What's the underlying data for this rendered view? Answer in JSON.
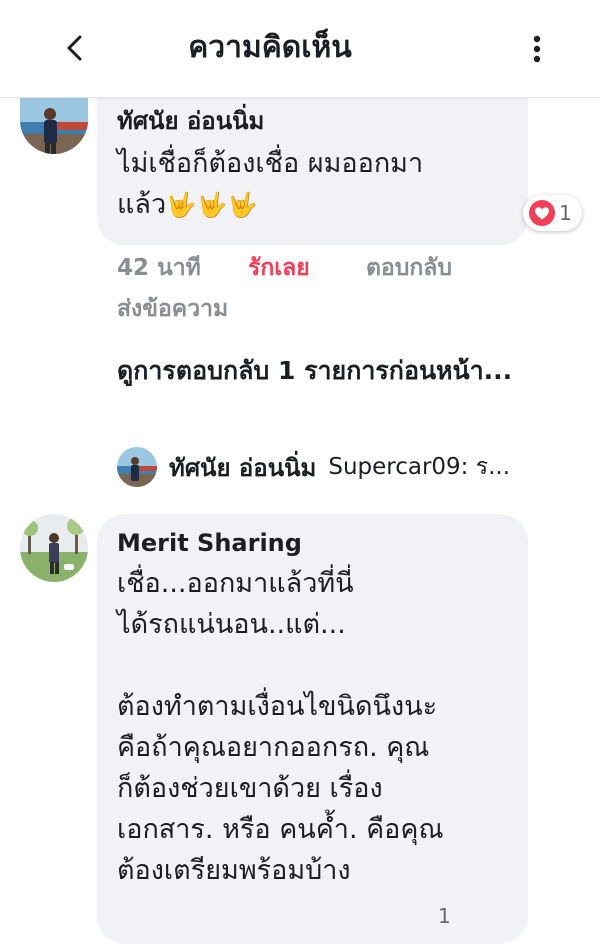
{
  "header": {
    "title": "ความคิดเห็น",
    "back_icon": "chevron-left-icon",
    "menu_icon": "more-vertical-icon"
  },
  "comments": [
    {
      "author": "ทัศนัย อ่อนนิ่ม",
      "text": "ไม่เชื่อก็ต้องเชื่อ ผมออกมา\nแล้ว",
      "emoji": "🤟🤟🤟",
      "reaction": {
        "icon": "heart-icon",
        "count": "1",
        "color": "#f33e58"
      },
      "time": "42 นาที",
      "like": "รักเลย",
      "reply": "ตอบกลับ",
      "message": "ส่งข้อความ"
    },
    {
      "author": "Merit Sharing",
      "text": "เชื่อ...ออกมาแล้วที่นี่\nได้รถแน่นอน..แต่...\n\nต้องทำตามเงื่อนไขนิดนึงนะ\nคือถ้าคุณอยากออกรถ. คุณ\nก็ต้องช่วยเขาด้วย เรื่อง\nเอกสาร. หรือ คนค้ำ. คือคุณ\nต้องเตรียมพร้อมบ้าง",
      "reaction_count": "1"
    }
  ],
  "replies": {
    "view_previous": "ดูการตอบกลับ 1 รายการก่อนหน้า...",
    "preview_author": "ทัศนัย อ่อนนิ่ม",
    "preview_text": "Supercar09: ร..."
  },
  "colors": {
    "love": "#f33e58",
    "bubble": "#f0f2f5",
    "meta": "#8a8d91"
  }
}
